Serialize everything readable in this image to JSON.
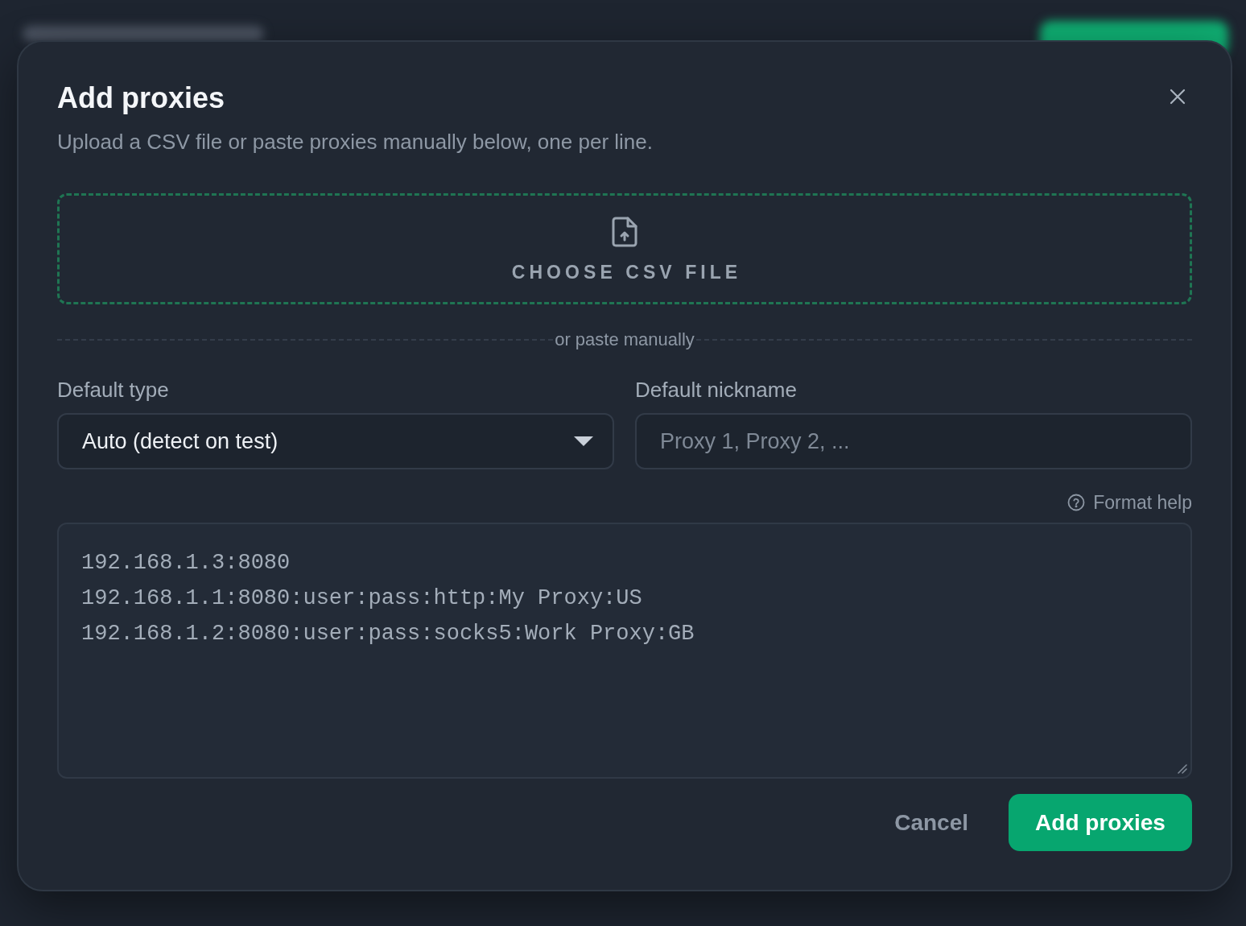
{
  "dialog": {
    "title": "Add proxies",
    "description": "Upload a CSV file or paste proxies manually below, one per line.",
    "upload": {
      "label": "CHOOSE CSV FILE"
    },
    "divider_label": "or paste manually",
    "fields": [
      {
        "kind": "select",
        "label": "Default type",
        "value": "Auto (detect on test)"
      },
      {
        "kind": "text",
        "label": "Default nickname",
        "placeholder": "Proxy 1, Proxy 2, ..."
      }
    ],
    "format_help": "Format help",
    "proxy_list": {
      "lines": [
        "192.168.1.3:8080",
        "192.168.1.1:8080:user:pass:http:My Proxy:US",
        "192.168.1.2:8080:user:pass:socks5:Work Proxy:GB"
      ]
    },
    "actions": [
      {
        "kind": "secondary",
        "label": "Cancel"
      },
      {
        "kind": "primary",
        "label": "Add proxies"
      }
    ]
  }
}
